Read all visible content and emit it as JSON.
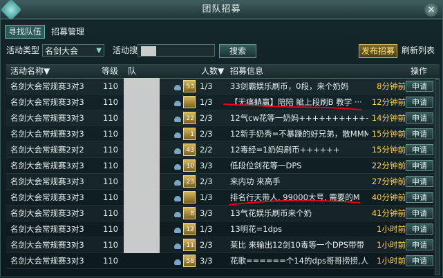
{
  "window": {
    "title": "团队招募"
  },
  "tabs": [
    "寻找队伍",
    "招募管理"
  ],
  "filter": {
    "activity_type_label": "活动类型",
    "activity_type_value": "名剑大会",
    "search_label": "活动搜",
    "search_button": "搜索",
    "post_button": "发布招募",
    "refresh_button": "刷新列表"
  },
  "table": {
    "headers": [
      "活动名称",
      "等级",
      "队",
      "人数",
      "招募信息",
      "操作"
    ],
    "rows": [
      {
        "name": "名剑大会常规赛3对3",
        "level": "110",
        "leader": "",
        "badge": "53",
        "count": "1/3",
        "info": "33剑霸娱乐刷币，0段，来个奶妈",
        "time": "8分钟前",
        "action": "申请"
      },
      {
        "name": "名剑大会常规赛3对3",
        "level": "110",
        "leader": "",
        "badge": "",
        "count": "1/3",
        "info": "【无痛躺赢】陪陪 眦上段刷B 教学 ···",
        "time": "12分钟前",
        "action": "申请"
      },
      {
        "name": "名剑大会常规赛3对3",
        "level": "110",
        "leader": "",
        "badge": "22",
        "count": "2/3",
        "info": "12气cw花等一奶妈++++++++++++++",
        "time": "14分钟前",
        "action": "申请"
      },
      {
        "name": "名剑大会常规赛3对3",
        "level": "110",
        "leader": "",
        "badge": "1",
        "count": "2/3",
        "info": "12新手奶秀=不暴躁的好兄弟，散MMM",
        "time": "15分钟前",
        "action": "申请"
      },
      {
        "name": "名剑大会常规赛2对2",
        "level": "110",
        "leader": "",
        "badge": "43",
        "count": "2/2",
        "info": "12毒经=1奶妈刷币++++++",
        "time": "15分钟前",
        "action": "申请"
      },
      {
        "name": "名剑大会常规赛3对3",
        "level": "110",
        "leader": "",
        "badge": "10",
        "count": "3/3",
        "info": "低段位剑花等一DPS",
        "time": "22分钟前",
        "action": "申请"
      },
      {
        "name": "名剑大会常规赛3对3",
        "level": "110",
        "leader": "",
        "badge": "23",
        "count": "2/3",
        "info": "来内功  来高手",
        "time": "27分钟前",
        "action": "申请"
      },
      {
        "name": "名剑大会常规赛3对3",
        "level": "110",
        "leader": "",
        "badge": "",
        "count": "1/3",
        "info": "排名行天带人, 99000大号, 需要的M",
        "time": "40分钟前",
        "action": "申请"
      },
      {
        "name": "名剑大会常规赛3对3",
        "level": "110",
        "leader": "",
        "badge": "8",
        "count": "3/3",
        "info": "13气花娱乐刷币来个奶",
        "time": "41分钟前",
        "action": "申请"
      },
      {
        "name": "名剑大会常规赛3对3",
        "level": "110",
        "leader": "",
        "badge": "12",
        "count": "1/3",
        "info": "13明花=1dps",
        "time": "1小时前",
        "action": "申请"
      },
      {
        "name": "名剑大会常规赛3对3",
        "level": "110",
        "leader": "",
        "badge": "11",
        "count": "2/3",
        "info": "莱比   来输出12剑10毒等一个DPS带带",
        "time": "1小时前",
        "action": "申请"
      },
      {
        "name": "名剑大会常规赛3对3",
        "level": "110",
        "leader": "",
        "badge": "58",
        "count": "3/3",
        "info": "花歌======个14的dps哥哥捞捞,人···",
        "time": "1小时前",
        "action": "申请"
      }
    ]
  },
  "colors": {
    "time": "#ffd35a",
    "accent": "#6fb2ae",
    "gold": "#ffe27a",
    "annotation": "#e0001b"
  }
}
